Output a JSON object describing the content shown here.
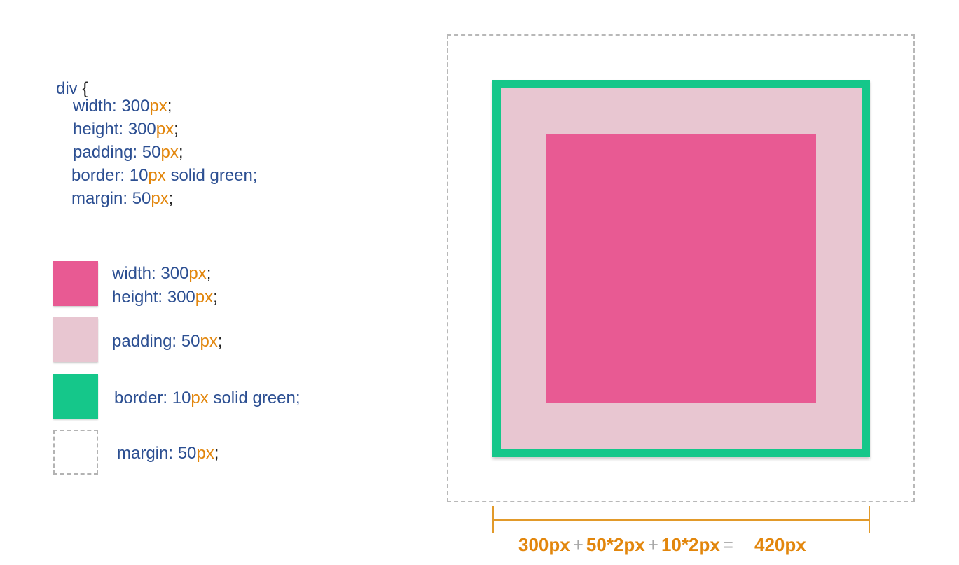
{
  "code": {
    "selector": "div",
    "open_brace": "{",
    "width_prop": "width: ",
    "width_num": "300",
    "height_prop": "height: ",
    "height_num": "300",
    "padding_prop": "padding: ",
    "padding_num": "50",
    "border_prop": "border: ",
    "border_num": "10",
    "border_rest": " solid green;",
    "margin_prop": "margin: ",
    "margin_num": "50",
    "unit": "px",
    "semicolon": ";"
  },
  "legend": {
    "width_prop": "width: ",
    "width_num": "300",
    "height_prop": "height: ",
    "height_num": "300",
    "padding_prop": "padding: ",
    "padding_num": "50",
    "border_prop": "border: ",
    "border_num": "10",
    "border_rest": " solid green;",
    "margin_prop": "margin: ",
    "margin_num": "50",
    "unit": "px",
    "semicolon": ";"
  },
  "formula": {
    "term1": "300px",
    "plus1": "+",
    "term2": "50*2px",
    "plus2": "+",
    "term3": "10*2px",
    "equals": "=",
    "result": "420px"
  },
  "colors": {
    "content": "#e85a93",
    "padding": "#e8c6d1",
    "border": "#15c78a",
    "margin_outline": "#b8b8b8",
    "text_blue": "#2c4f92",
    "text_orange": "#e2860c",
    "dimension_line": "#e29a2a"
  }
}
